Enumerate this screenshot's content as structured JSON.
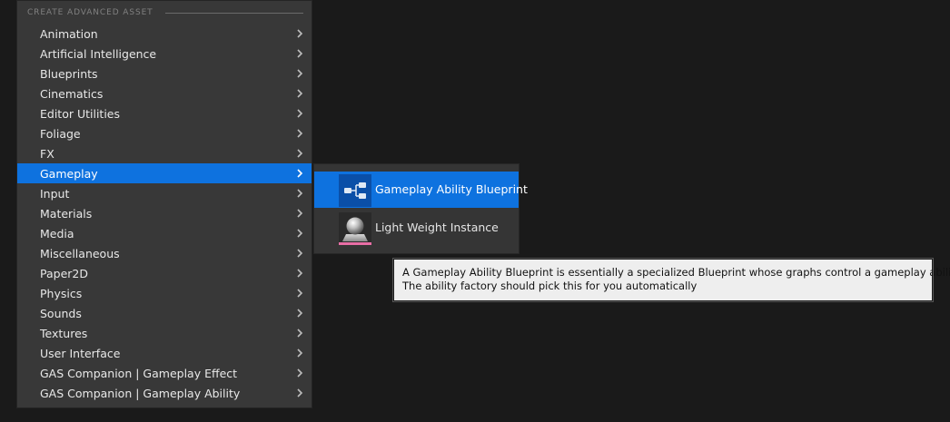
{
  "menu": {
    "section_header": "CREATE ADVANCED ASSET",
    "items": [
      {
        "label": "Animation"
      },
      {
        "label": "Artificial Intelligence"
      },
      {
        "label": "Blueprints"
      },
      {
        "label": "Cinematics"
      },
      {
        "label": "Editor Utilities"
      },
      {
        "label": "Foliage"
      },
      {
        "label": "FX"
      },
      {
        "label": "Gameplay",
        "selected": true
      },
      {
        "label": "Input"
      },
      {
        "label": "Materials"
      },
      {
        "label": "Media"
      },
      {
        "label": "Miscellaneous"
      },
      {
        "label": "Paper2D"
      },
      {
        "label": "Physics"
      },
      {
        "label": "Sounds"
      },
      {
        "label": "Textures"
      },
      {
        "label": "User Interface"
      },
      {
        "label": "GAS Companion | Gameplay Effect"
      },
      {
        "label": "GAS Companion | Gameplay Ability"
      }
    ],
    "submenu_icon": "chevron-right-icon"
  },
  "submenu": {
    "items": [
      {
        "label": "Gameplay Ability Blueprint",
        "icon": "blueprint-graph-icon",
        "highlighted": true
      },
      {
        "label": "Light Weight Instance",
        "icon": "sphere-mesh-icon",
        "highlighted": false
      }
    ]
  },
  "tooltip": {
    "line1": "A Gameplay Ability Blueprint is essentially a specialized Blueprint whose graphs control a gameplay ability",
    "line2": "The ability factory should pick this for you automatically"
  },
  "colors": {
    "background": "#1a1a1a",
    "menu_bg": "#383838",
    "selection": "#0e72df",
    "tooltip_bg": "#eeeeee",
    "asset_underline": "#e86ea5"
  }
}
